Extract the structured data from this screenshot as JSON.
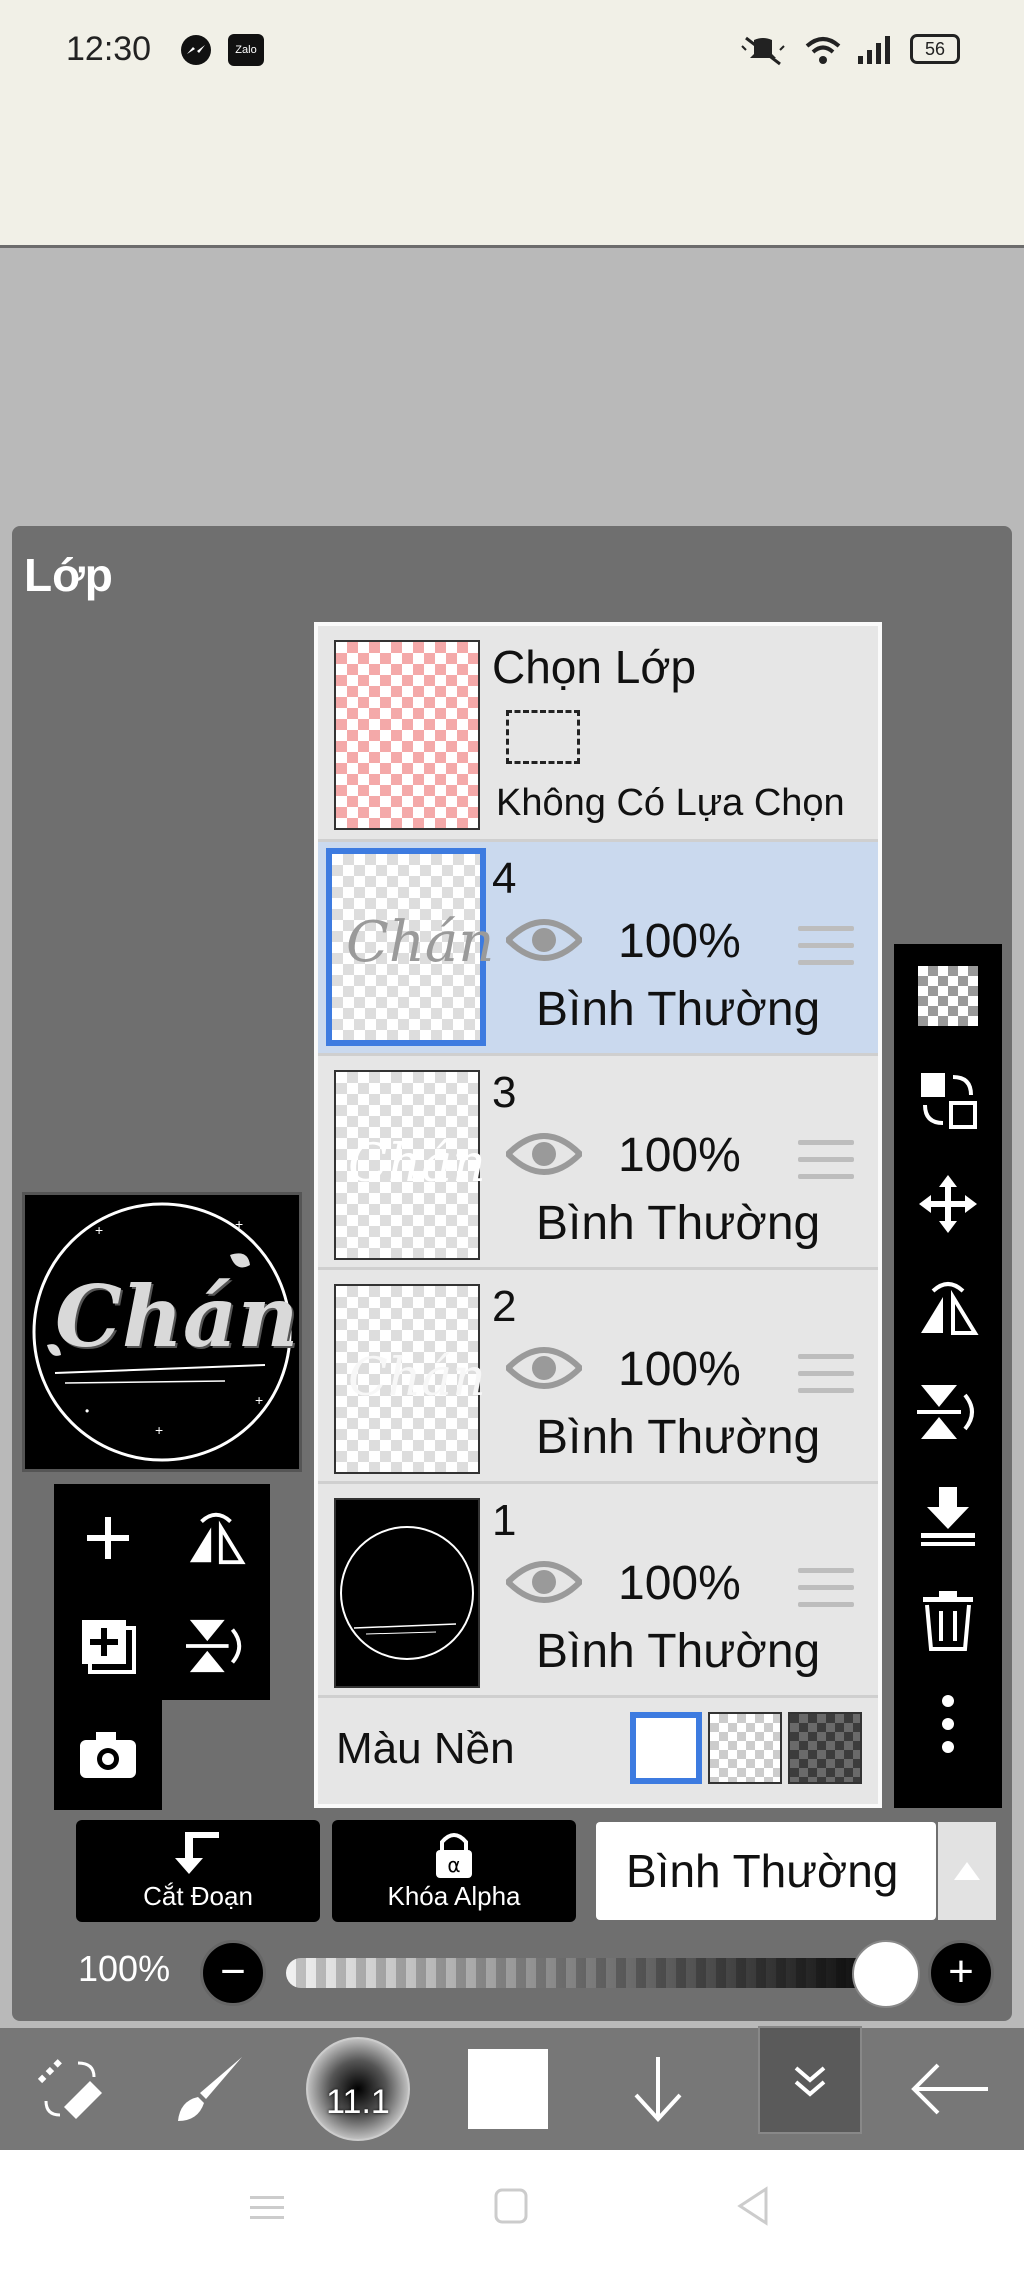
{
  "status_bar": {
    "time": "12:30",
    "icons": [
      "messenger-icon",
      "zalo-icon",
      "silent-icon",
      "wifi-icon",
      "signal-icon",
      "battery-icon"
    ],
    "zalo_label": "Zalo",
    "battery": "56"
  },
  "panel": {
    "title": "Lớp"
  },
  "selection_row": {
    "title": "Chọn Lớp",
    "status": "Không Có Lựa Chọn"
  },
  "layers": [
    {
      "number": "4",
      "opacity": "100%",
      "blend": "Bình Thường",
      "thumb_text": "Chán",
      "selected": true
    },
    {
      "number": "3",
      "opacity": "100%",
      "blend": "Bình Thường",
      "thumb_text": "Chán",
      "selected": false
    },
    {
      "number": "2",
      "opacity": "100%",
      "blend": "Bình Thường",
      "thumb_text": "Chán",
      "selected": false
    },
    {
      "number": "1",
      "opacity": "100%",
      "blend": "Bình Thường",
      "selected": false
    }
  ],
  "background_row": {
    "label": "Màu Nền",
    "options": [
      "white",
      "transparent",
      "dark-checker"
    ],
    "selected": "white"
  },
  "preview": {
    "text": "Chán"
  },
  "right_toolbar": [
    "checker-icon",
    "swap-layers-icon",
    "move-icon",
    "flip-horizontal-icon",
    "flip-vertical-icon",
    "merge-down-icon",
    "trash-icon",
    "more-vert-icon"
  ],
  "left_tools": [
    "add-layer-icon",
    "flip-layer-h-icon",
    "add-copy-icon",
    "flip-layer-v-icon",
    "camera-icon"
  ],
  "bottom_controls": {
    "clip_label": "Cắt Đoạn",
    "alpha_lock_label": "Khóa Alpha",
    "blend_mode": "Bình Thường"
  },
  "opacity": {
    "label": "100%",
    "value": 1.0,
    "minus": "−",
    "plus": "+"
  },
  "app_toolbar": {
    "brush_size": "11.1",
    "items": [
      "transform-icon",
      "brush-icon",
      "brush-size",
      "color-swatch",
      "arrow-down-icon",
      "layers-collapse-icon",
      "back-icon"
    ],
    "color": "#ffffff"
  },
  "nav_bar": [
    "menu-icon",
    "home-icon",
    "back-triangle-icon"
  ],
  "colors": {
    "selected_row": "#cad9ee",
    "selected_border": "#3d7be0",
    "selection_thumb": "#f4a9a9"
  }
}
